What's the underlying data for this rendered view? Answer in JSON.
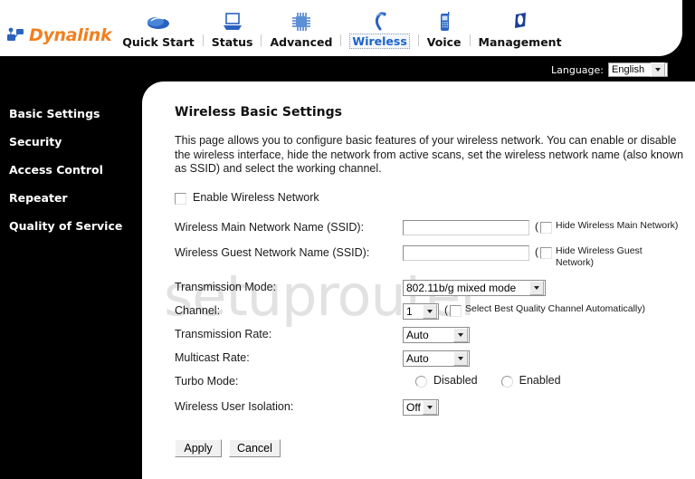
{
  "brand": {
    "name": "Dynalink",
    "logo_icon": "network-nodes-icon"
  },
  "nav": {
    "items": [
      {
        "label": "Quick Start",
        "icon": "mouse-icon",
        "active": false
      },
      {
        "label": "Status",
        "icon": "laptop-icon",
        "active": false
      },
      {
        "label": "Advanced",
        "icon": "chip-icon",
        "active": false
      },
      {
        "label": "Wireless",
        "icon": "wireless-antenna-icon",
        "active": true
      },
      {
        "label": "Voice",
        "icon": "mobile-phone-icon",
        "active": false
      },
      {
        "label": "Management",
        "icon": "flag-icon",
        "active": false
      }
    ]
  },
  "language": {
    "label": "Language:",
    "value": "English"
  },
  "sidebar": {
    "items": [
      {
        "label": "Basic Settings"
      },
      {
        "label": "Security"
      },
      {
        "label": "Access Control"
      },
      {
        "label": "Repeater"
      },
      {
        "label": "Quality of Service"
      }
    ]
  },
  "watermark": "setuprouter",
  "page": {
    "title": "Wireless Basic Settings",
    "description": "This page allows you to configure basic features of your wireless network. You can enable or disable the wireless interface, hide the network from active scans, set the wireless network name (also known as SSID) and select the working channel."
  },
  "form": {
    "enable_wireless": {
      "label": "Enable Wireless Network",
      "checked": false
    },
    "main_ssid": {
      "label": "Wireless Main Network Name (SSID):",
      "value": "",
      "hide_note_open": "(",
      "hide_label": "Hide Wireless Main Network)",
      "hide_checked": false
    },
    "guest_ssid": {
      "label": "Wireless Guest Network Name (SSID):",
      "value": "",
      "hide_note_open": "(",
      "hide_label": "Hide Wireless Guest Network)",
      "hide_checked": false
    },
    "transmission_mode": {
      "label": "Transmission Mode:",
      "value": "802.11b/g mixed mode"
    },
    "channel": {
      "label": "Channel:",
      "value": "1",
      "auto_note_open": "(",
      "auto_label": "Select Best Quality Channel Automatically)",
      "auto_checked": false
    },
    "transmission_rate": {
      "label": "Transmission Rate:",
      "value": "Auto"
    },
    "multicast_rate": {
      "label": "Multicast Rate:",
      "value": "Auto"
    },
    "turbo_mode": {
      "label": "Turbo Mode:",
      "disabled_label": "Disabled",
      "enabled_label": "Enabled",
      "selected": ""
    },
    "user_isolation": {
      "label": "Wireless User Isolation:",
      "value": "Off"
    }
  },
  "buttons": {
    "apply": "Apply",
    "cancel": "Cancel"
  }
}
